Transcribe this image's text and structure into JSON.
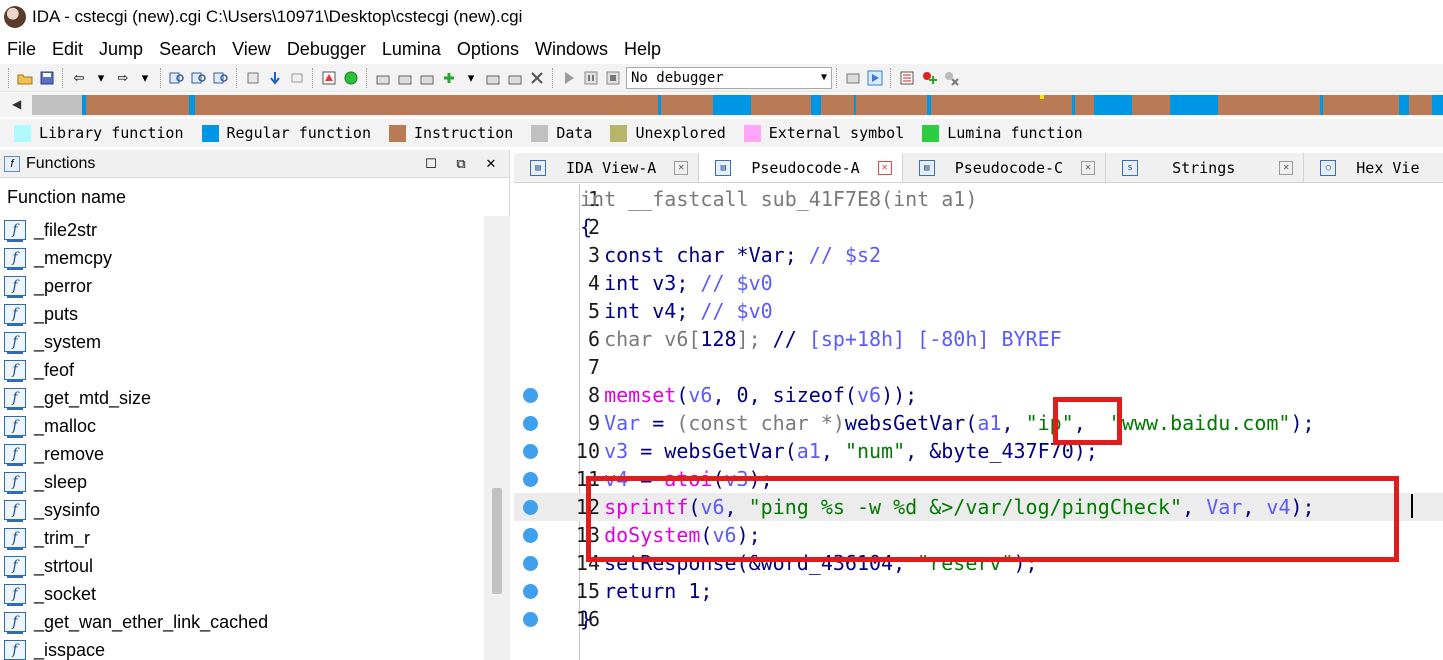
{
  "window": {
    "title": "IDA - cstecgi (new).cgi C:\\Users\\10971\\Desktop\\cstecgi (new).cgi"
  },
  "menu": [
    "File",
    "Edit",
    "Jump",
    "Search",
    "View",
    "Debugger",
    "Lumina",
    "Options",
    "Windows",
    "Help"
  ],
  "toolbar": {
    "debugger_select": "No debugger"
  },
  "legend": [
    {
      "label": "Library function",
      "color": "#aefbff"
    },
    {
      "label": "Regular function",
      "color": "#0096e6"
    },
    {
      "label": "Instruction",
      "color": "#b97a56"
    },
    {
      "label": "Data",
      "color": "#c0c0c0"
    },
    {
      "label": "Unexplored",
      "color": "#b8b46a"
    },
    {
      "label": "External symbol",
      "color": "#ffa6f8"
    },
    {
      "label": "Lumina function",
      "color": "#2ecc40"
    }
  ],
  "functions_panel": {
    "title": "Functions",
    "column_header": "Function name",
    "items": [
      "_file2str",
      "_memcpy",
      "_perror",
      "_puts",
      "_system",
      "_feof",
      "_get_mtd_size",
      "_malloc",
      "_remove",
      "_sleep",
      "_sysinfo",
      "_trim_r",
      "_strtoul",
      "_socket",
      "_get_wan_ether_link_cached",
      "_isspace"
    ]
  },
  "tabs": [
    {
      "label": "IDA View-A",
      "active": false
    },
    {
      "label": "Pseudocode-A",
      "active": true
    },
    {
      "label": "Pseudocode-C",
      "active": false
    },
    {
      "label": "Strings",
      "active": false
    },
    {
      "label": "Hex Vie",
      "active": false
    }
  ],
  "pseudocode": {
    "lines": [
      {
        "n": "1",
        "text": "int __fastcall sub_41F7E8(int a1)",
        "dot": false
      },
      {
        "n": "2",
        "text": "{",
        "dot": false
      },
      {
        "n": "3",
        "text": "  const char *Var; // $s2",
        "dot": false
      },
      {
        "n": "4",
        "text": "  int v3; // $v0",
        "dot": false
      },
      {
        "n": "5",
        "text": "  int v4; // $v0",
        "dot": false
      },
      {
        "n": "6",
        "text": "  char v6[128]; // [sp+18h] [-80h] BYREF",
        "dot": false
      },
      {
        "n": "7",
        "text": "",
        "dot": false
      },
      {
        "n": "8",
        "text": "  memset(v6, 0, sizeof(v6));",
        "dot": true
      },
      {
        "n": "9",
        "text": "  Var = (const char *)websGetVar(a1, \"ip\", \"www.baidu.com\");",
        "dot": true
      },
      {
        "n": "10",
        "text": "  v3 = websGetVar(a1, \"num\", &byte_437F70);",
        "dot": true
      },
      {
        "n": "11",
        "text": "  v4 = atoi(v3);",
        "dot": true
      },
      {
        "n": "12",
        "text": "  sprintf(v6, \"ping %s -w %d &>/var/log/pingCheck\", Var, v4);",
        "dot": true
      },
      {
        "n": "13",
        "text": "  doSystem(v6);",
        "dot": true
      },
      {
        "n": "14",
        "text": "  setResponse(&word_436104, \"reserv\");",
        "dot": true
      },
      {
        "n": "15",
        "text": "  return 1;",
        "dot": true
      },
      {
        "n": "16",
        "text": "}",
        "dot": true
      }
    ]
  }
}
